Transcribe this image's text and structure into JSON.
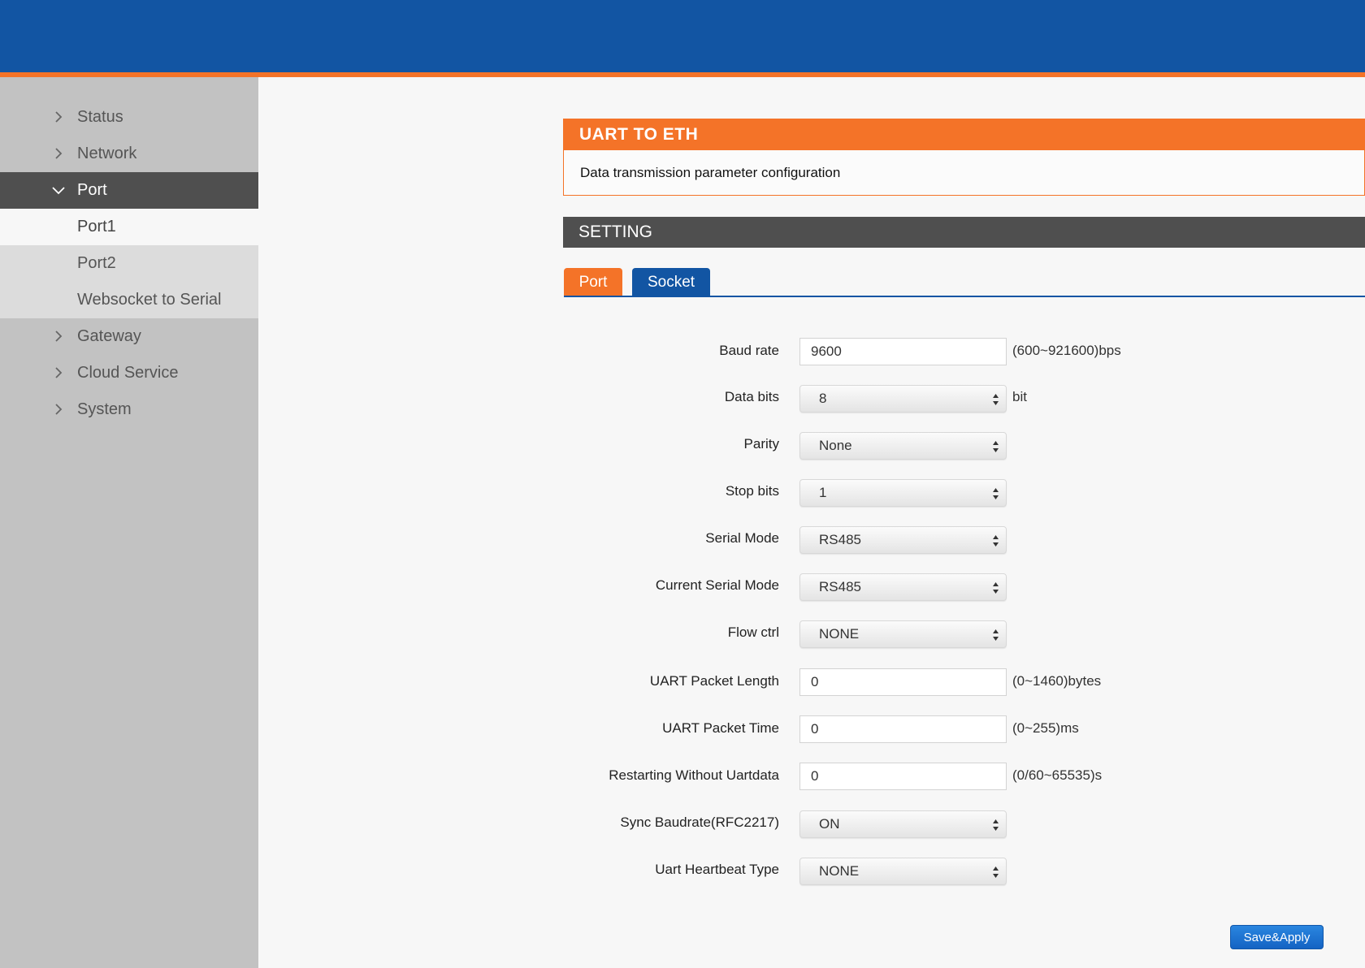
{
  "colors": {
    "header_blue": "#1255a3",
    "accent_orange": "#f47328",
    "dark_gray": "#4f4f4f",
    "sidebar_gray": "#c2c2c2"
  },
  "sidebar": {
    "items": [
      {
        "label": "Status",
        "icon": "chevron-right-icon"
      },
      {
        "label": "Network",
        "icon": "chevron-right-icon"
      },
      {
        "label": "Port",
        "icon": "chevron-down-icon",
        "active": true
      },
      {
        "label": "Gateway",
        "icon": "chevron-right-icon"
      },
      {
        "label": "Cloud Service",
        "icon": "chevron-right-icon"
      },
      {
        "label": "System",
        "icon": "chevron-right-icon"
      }
    ],
    "port_sub": [
      {
        "label": "Port1",
        "selected": true
      },
      {
        "label": "Port2"
      },
      {
        "label": "Websocket to Serial"
      }
    ]
  },
  "panel": {
    "title": "UART TO ETH",
    "description": "Data transmission parameter configuration"
  },
  "setting": {
    "title": "SETTING"
  },
  "tabs": [
    {
      "label": "Port",
      "active": true
    },
    {
      "label": "Socket"
    }
  ],
  "form": {
    "baud_rate": {
      "label": "Baud rate",
      "value": "9600",
      "hint": "(600~921600)bps"
    },
    "data_bits": {
      "label": "Data bits",
      "value": "8",
      "hint": "bit"
    },
    "parity": {
      "label": "Parity",
      "value": "None"
    },
    "stop_bits": {
      "label": "Stop bits",
      "value": "1"
    },
    "serial_mode": {
      "label": "Serial Mode",
      "value": "RS485"
    },
    "current_serial_mode": {
      "label": "Current Serial Mode",
      "value": "RS485"
    },
    "flow_ctrl": {
      "label": "Flow ctrl",
      "value": "NONE"
    },
    "packet_length": {
      "label": "UART Packet Length",
      "value": "0",
      "hint": "(0~1460)bytes"
    },
    "packet_time": {
      "label": "UART Packet Time",
      "value": "0",
      "hint": "(0~255)ms"
    },
    "restart_no_data": {
      "label": "Restarting Without Uartdata",
      "value": "0",
      "hint": "(0/60~65535)s"
    },
    "sync_baudrate": {
      "label": "Sync Baudrate(RFC2217)",
      "value": "ON"
    },
    "heartbeat_type": {
      "label": "Uart Heartbeat Type",
      "value": "NONE"
    }
  },
  "save_button": {
    "label": "Save&Apply"
  }
}
